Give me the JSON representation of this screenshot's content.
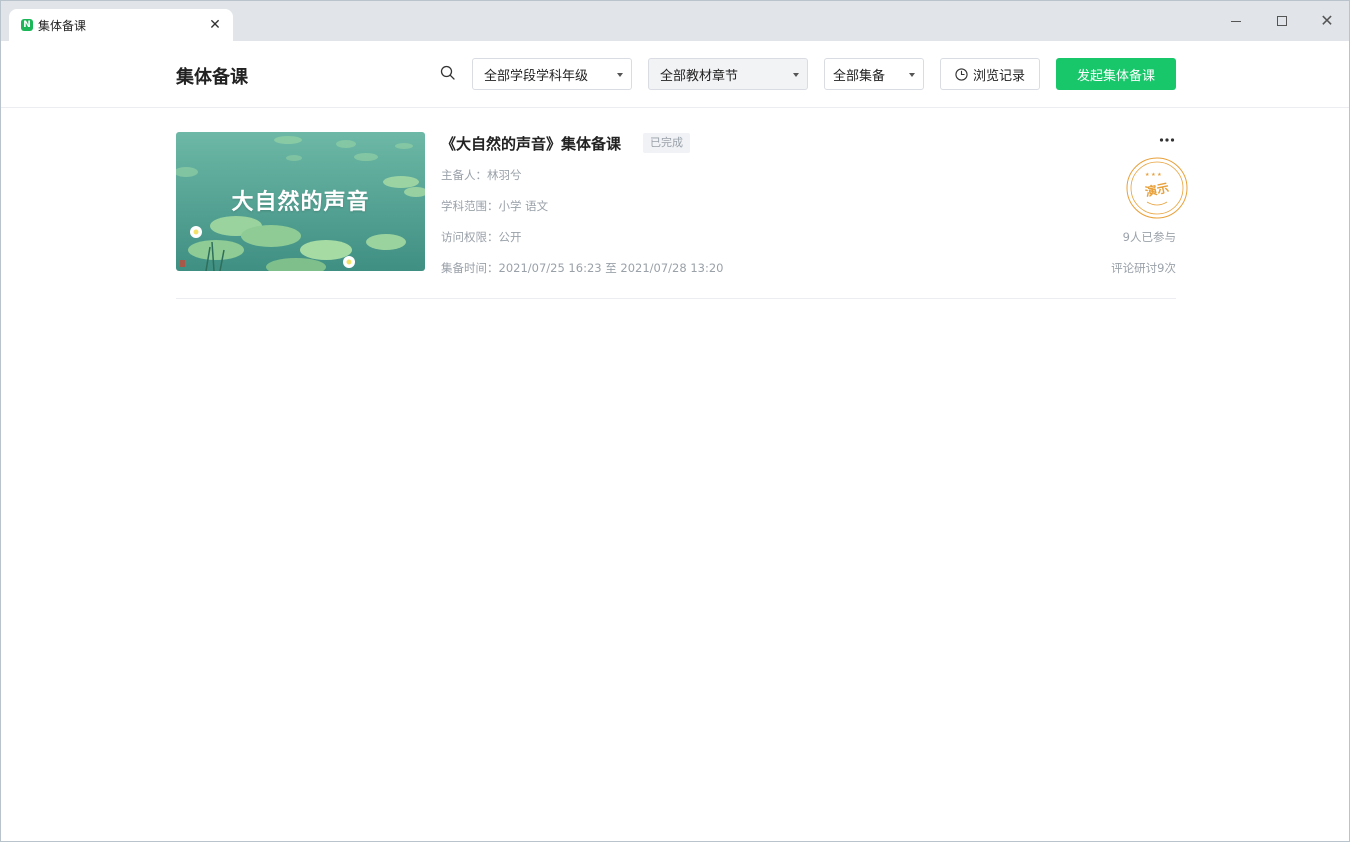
{
  "window": {
    "tab_title": "集体备课",
    "tab_logo_letter": "N"
  },
  "header": {
    "page_title": "集体备课",
    "filters": {
      "grade": "全部学段学科年级",
      "chapter": "全部教材章节",
      "type": "全部集备"
    },
    "history_label": "浏览记录",
    "create_label": "发起集体备课"
  },
  "lessons": [
    {
      "thumbnail_text": "大自然的声音",
      "title": "《大自然的声音》集体备课",
      "status": "已完成",
      "host": "主备人：林羽兮",
      "subject": "学科范围：小学 语文",
      "access": "访问权限：公开",
      "time": "集备时间：2021/07/25 16:23 至 2021/07/28 13:20",
      "stamp": "演示",
      "participants": "9人已参与",
      "comments": "评论研讨9次"
    }
  ],
  "colors": {
    "brand_green": "#17c76a",
    "stamp_orange": "#e8a13a"
  }
}
